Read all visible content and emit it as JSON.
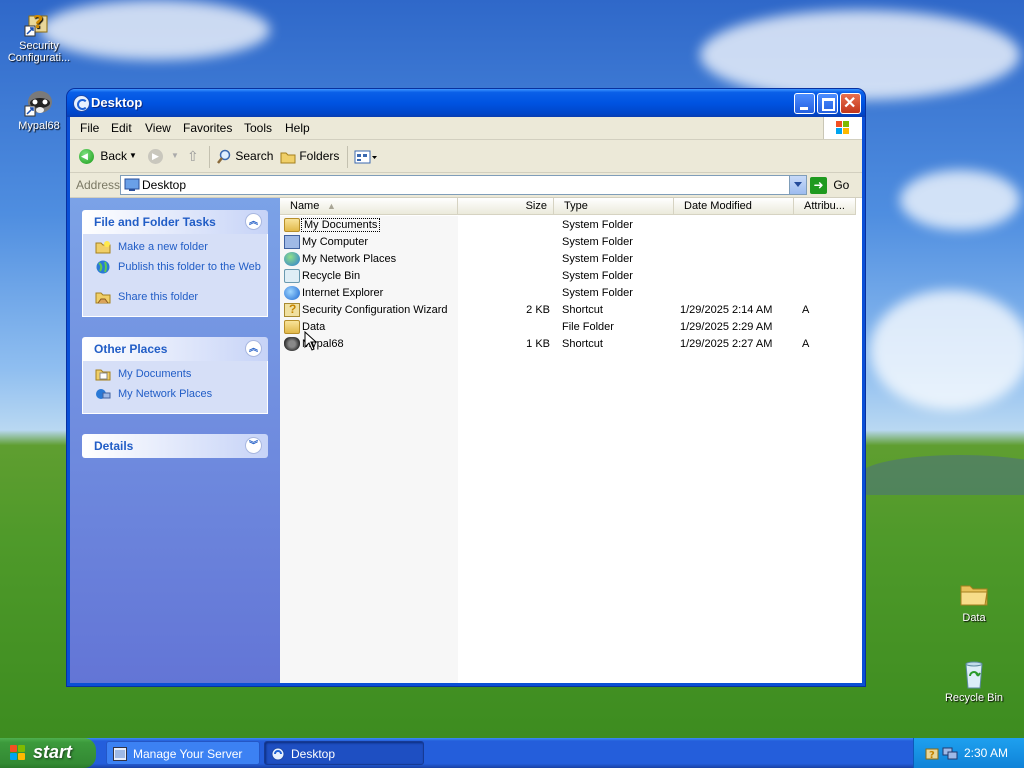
{
  "desktop": {
    "icons": [
      {
        "label": "Security Configurati...",
        "icon": "security-wizard-icon"
      },
      {
        "label": "Mypal68",
        "icon": "raccoon-icon"
      },
      {
        "label": "Data",
        "icon": "folder-icon"
      },
      {
        "label": "Recycle Bin",
        "icon": "recycle-bin-icon"
      }
    ]
  },
  "window": {
    "title": "Desktop",
    "menu": [
      "File",
      "Edit",
      "View",
      "Favorites",
      "Tools",
      "Help"
    ],
    "toolbar": {
      "back": "Back",
      "search": "Search",
      "folders": "Folders"
    },
    "address": {
      "label": "Address",
      "value": "Desktop",
      "go": "Go"
    },
    "tasks": {
      "file_folder": {
        "title": "File and Folder Tasks",
        "items": [
          "Make a new folder",
          "Publish this folder to the Web",
          "Share this folder"
        ]
      },
      "other_places": {
        "title": "Other Places",
        "items": [
          "My Documents",
          "My Network Places"
        ]
      },
      "details": {
        "title": "Details"
      }
    },
    "columns": {
      "name": "Name",
      "size": "Size",
      "type": "Type",
      "date": "Date Modified",
      "attr": "Attribu..."
    },
    "files": [
      {
        "name": "My Documents",
        "size": "",
        "type": "System Folder",
        "date": "",
        "attr": "",
        "icon": "folder"
      },
      {
        "name": "My Computer",
        "size": "",
        "type": "System Folder",
        "date": "",
        "attr": "",
        "icon": "computer"
      },
      {
        "name": "My Network Places",
        "size": "",
        "type": "System Folder",
        "date": "",
        "attr": "",
        "icon": "globe"
      },
      {
        "name": "Recycle Bin",
        "size": "",
        "type": "System Folder",
        "date": "",
        "attr": "",
        "icon": "recycle"
      },
      {
        "name": "Internet Explorer",
        "size": "",
        "type": "System Folder",
        "date": "",
        "attr": "",
        "icon": "ie"
      },
      {
        "name": "Security Configuration Wizard",
        "size": "2 KB",
        "type": "Shortcut",
        "date": "1/29/2025 2:14 AM",
        "attr": "A",
        "icon": "wizard"
      },
      {
        "name": "Data",
        "size": "",
        "type": "File Folder",
        "date": "1/29/2025 2:29 AM",
        "attr": "",
        "icon": "folder"
      },
      {
        "name": "Mypal68",
        "size": "1 KB",
        "type": "Shortcut",
        "date": "1/29/2025 2:27 AM",
        "attr": "A",
        "icon": "raccoon"
      }
    ]
  },
  "taskbar": {
    "start": "start",
    "tasks": [
      {
        "label": "Manage Your Server",
        "active": false
      },
      {
        "label": "Desktop",
        "active": true
      }
    ],
    "clock": "2:30 AM"
  }
}
